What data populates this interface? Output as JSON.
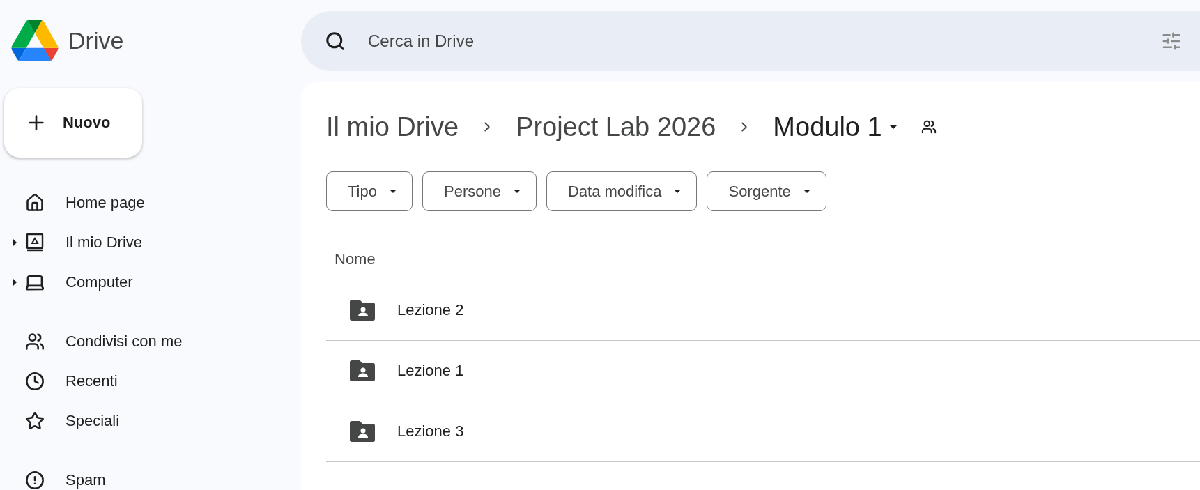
{
  "app": {
    "name": "Drive"
  },
  "search": {
    "placeholder": "Cerca in Drive"
  },
  "new_button": {
    "label": "Nuovo"
  },
  "sidebar": {
    "sections": [
      [
        {
          "label": "Home page",
          "kind": "home",
          "expandable": false
        },
        {
          "label": "Il mio Drive",
          "kind": "drive",
          "expandable": true
        },
        {
          "label": "Computer",
          "kind": "computer",
          "expandable": true
        }
      ],
      [
        {
          "label": "Condivisi con me",
          "kind": "shared",
          "expandable": false
        },
        {
          "label": "Recenti",
          "kind": "recent",
          "expandable": false
        },
        {
          "label": "Speciali",
          "kind": "star",
          "expandable": false
        }
      ],
      [
        {
          "label": "Spam",
          "kind": "spam",
          "expandable": false
        }
      ]
    ]
  },
  "breadcrumb": [
    {
      "label": "Il mio Drive",
      "current": false
    },
    {
      "label": "Project Lab 2026",
      "current": false
    },
    {
      "label": "Modulo 1",
      "current": true
    }
  ],
  "filters": [
    {
      "label": "Tipo"
    },
    {
      "label": "Persone"
    },
    {
      "label": "Data modifica"
    },
    {
      "label": "Sorgente"
    }
  ],
  "table": {
    "columns": [
      "Nome"
    ],
    "rows": [
      {
        "name": "Lezione 2",
        "kind": "shared-folder"
      },
      {
        "name": "Lezione 1",
        "kind": "shared-folder"
      },
      {
        "name": "Lezione 3",
        "kind": "shared-folder"
      }
    ]
  }
}
